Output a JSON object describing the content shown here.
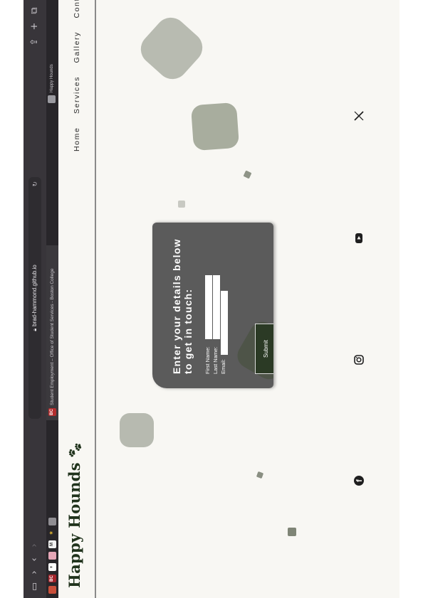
{
  "browser": {
    "address": "brad-hammond.github.io",
    "active_tab": "Student Employment – Office of Student Services - Boston College",
    "right_tab": "Happy Hounds",
    "reload_icon": "reload-icon"
  },
  "site": {
    "title": "Happy Hounds",
    "nav": [
      "Home",
      "Services",
      "Gallery",
      "Contact"
    ]
  },
  "form": {
    "heading": "Enter your details below to get in touch:",
    "first_label": "First Name:",
    "last_label": "Last Name:",
    "email_label": "Email:",
    "submit": "Submit"
  },
  "colors": {
    "chrome": "#38353a",
    "page_bg": "#f8f7f3",
    "brand": "#20331c",
    "card": "#5b5b5b",
    "blob": "#a9ad9f"
  },
  "social": [
    "facebook-icon",
    "instagram-icon",
    "youtube-icon",
    "x-icon"
  ]
}
